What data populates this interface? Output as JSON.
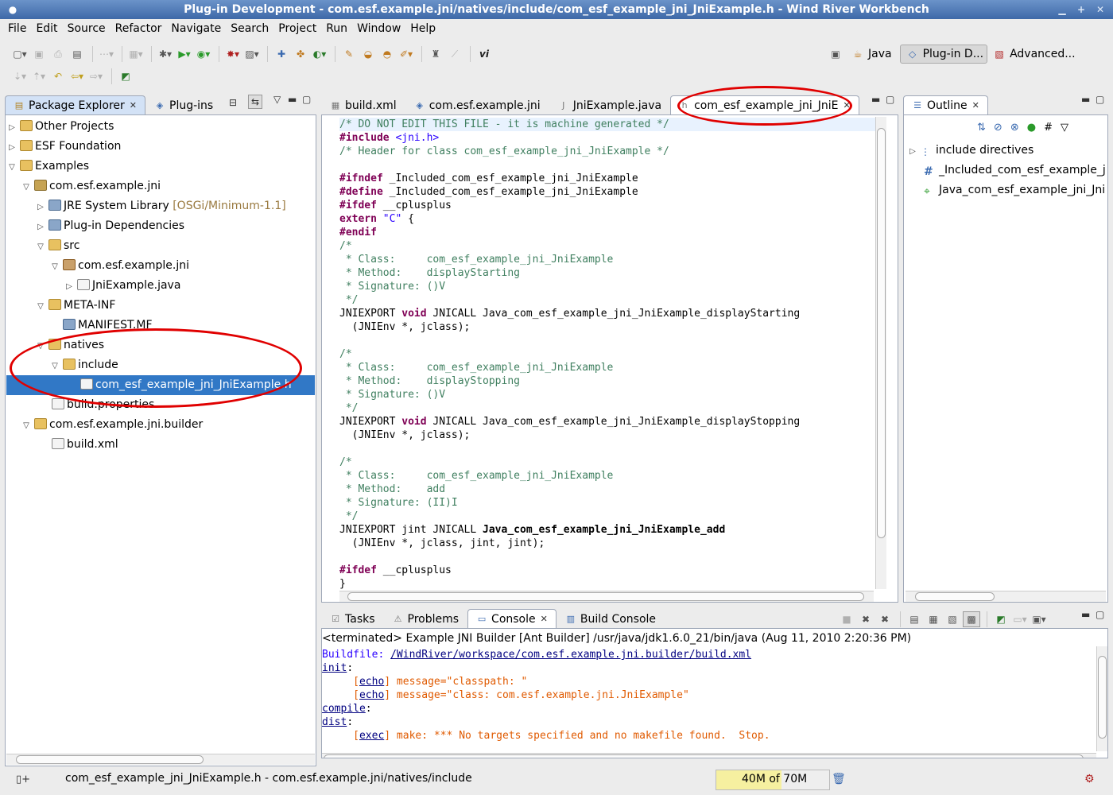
{
  "window": {
    "title": "Plug-in Development - com.esf.example.jni/natives/include/com_esf_example_jni_JniExample.h - Wind River Workbench"
  },
  "menu": [
    "File",
    "Edit",
    "Source",
    "Refactor",
    "Navigate",
    "Search",
    "Project",
    "Run",
    "Window",
    "Help"
  ],
  "perspectives": {
    "java": "Java",
    "plugin": "Plug-in D...",
    "advanced": "Advanced..."
  },
  "explorer": {
    "tabs": {
      "package_explorer": "Package Explorer",
      "plugins": "Plug-ins"
    },
    "tree": {
      "other_projects": "Other Projects",
      "esf_foundation": "ESF Foundation",
      "examples": "Examples",
      "project": "com.esf.example.jni",
      "jre": "JRE System Library",
      "jre_ann": "[OSGi/Minimum-1.1]",
      "plugin_deps": "Plug-in Dependencies",
      "src": "src",
      "pkg": "com.esf.example.jni",
      "java_file": "JniExample.java",
      "metainf": "META-INF",
      "manifest": "MANIFEST.MF",
      "natives": "natives",
      "include": "include",
      "header": "com_esf_example_jni_JniExample.h",
      "build_props": "build.properties",
      "builder": "com.esf.example.jni.builder",
      "build_xml": "build.xml"
    }
  },
  "editor": {
    "tabs": {
      "t1": "build.xml",
      "t2": "com.esf.example.jni",
      "t3": "JniExample.java",
      "t4": "com_esf_example_jni_JniE"
    },
    "lines": [
      "/* DO NOT EDIT THIS FILE - it is machine generated */",
      "#include",
      " <jni.h>",
      "/* Header for class com_esf_example_jni_JniExample */",
      "#ifndef",
      " _Included_com_esf_example_jni_JniExample",
      "#define",
      " _Included_com_esf_example_jni_JniExample",
      "#ifdef",
      " __cplusplus",
      "extern",
      " \"C\"",
      " {",
      "#endif",
      "/*",
      " * Class:     com_esf_example_jni_JniExample",
      " * Method:    displayStarting",
      " * Signature: ()V",
      " */",
      "JNIEXPORT",
      " void",
      " JNICALL Java_com_esf_example_jni_JniExample_displayStarting",
      "  (JNIEnv *, jclass);",
      " * Method:    displayStopping",
      " JNICALL Java_com_esf_example_jni_JniExample_displayStopping",
      " * Method:    add",
      " * Signature: (II)I",
      " jint JNICALL ",
      "Java_com_esf_example_jni_JniExample_add",
      "  (JNIEnv *, jclass, jint, jint);",
      "}"
    ]
  },
  "outline": {
    "tab": "Outline",
    "items": {
      "directives": "include directives",
      "macro": "_Included_com_esf_example_jni_JniExample",
      "fn": "Java_com_esf_example_jni_JniExample"
    }
  },
  "bottom": {
    "tabs": {
      "tasks": "Tasks",
      "problems": "Problems",
      "console": "Console",
      "build_console": "Build Console"
    },
    "console": {
      "header": "<terminated> Example JNI Builder [Ant Builder] /usr/java/jdk1.6.0_21/bin/java (Aug 11, 2010 2:20:36 PM)",
      "buildfile_label": "Buildfile: ",
      "buildfile_path": "/WindRiver/workspace/com.esf.example.jni.builder/build.xml",
      "init": "init",
      "colon": ":",
      "echo": "echo",
      "exec": "exec",
      "msg1": " message=\"classpath: \"",
      "msg2": " message=\"class: com.esf.example.jni.JniExample\"",
      "compile": "compile",
      "dist": "dist",
      "exec_msg": " make: *** No targets specified and no makefile found.  Stop."
    }
  },
  "status": {
    "path": "com_esf_example_jni_JniExample.h - com.esf.example.jni/natives/include",
    "heap": "40M of 70M"
  }
}
